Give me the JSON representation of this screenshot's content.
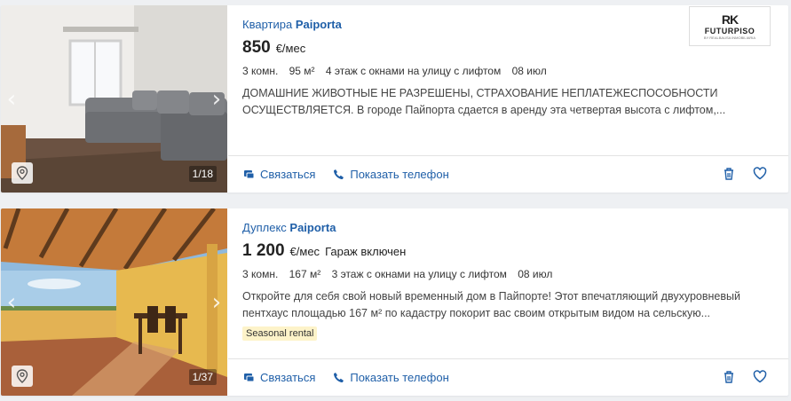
{
  "listings": [
    {
      "type": "Квартира",
      "location": "Paiporta",
      "price": "850",
      "price_unit": "€/мес",
      "price_extra": "",
      "details": [
        "3 комн.",
        "95 м²",
        "4 этаж с окнами на улицу с лифтом",
        "08 июл"
      ],
      "description": "ДОМАШНИЕ ЖИВОТНЫЕ НЕ РАЗРЕШЕНЫ, СТРАХОВАНИЕ НЕПЛАТЕЖЕСПОСОБНОСТИ ОСУЩЕСТВЛЯЕТСЯ. В городе Пайпорта сдается в аренду эта четвертая высота с лифтом,...",
      "tag": "",
      "photo_counter": "1/18",
      "agency_logo": {
        "mark": "RK",
        "name": "FUTURPISO",
        "sub": "BY REALBAUSA INMOBILIARIA"
      }
    },
    {
      "type": "Дуплекс",
      "location": "Paiporta",
      "price": "1 200",
      "price_unit": "€/мес",
      "price_extra": "Гараж включен",
      "details": [
        "3 комн.",
        "167 м²",
        "3 этаж с окнами на улицу с лифтом",
        "08 июл"
      ],
      "description": "Откройте для себя свой новый временный дом в Пайпорте! Этот впечатляющий двухуровневый пентхаус площадью 167 м² по кадастру покорит вас своим открытым видом на сельскую...",
      "tag": "Seasonal rental",
      "photo_counter": "1/37"
    }
  ],
  "actions": {
    "contact": "Связаться",
    "show_phone": "Показать телефон"
  },
  "icons": [
    "chevron-left-icon",
    "chevron-right-icon",
    "map-pin-icon",
    "chat-icon",
    "phone-icon",
    "trash-icon",
    "heart-icon"
  ],
  "colors": {
    "link": "#1f5fa8",
    "tag_bg": "#fdf3c9"
  }
}
